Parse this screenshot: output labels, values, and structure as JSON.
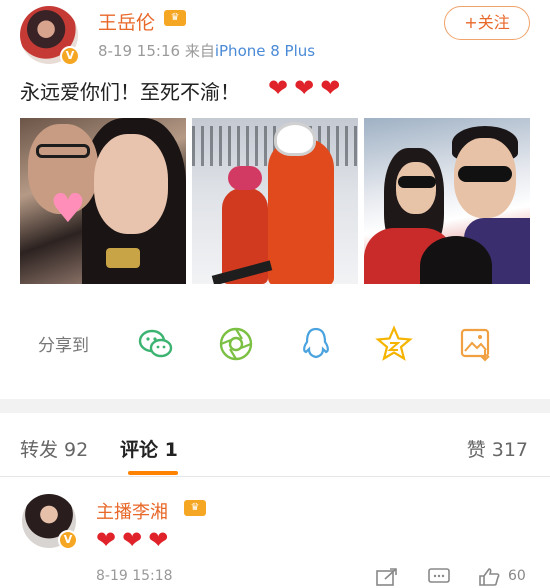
{
  "post": {
    "author_name": "王岳伦",
    "verified_badge": "V",
    "member_badge": "crown-icon",
    "date": "8-19 15:16",
    "source_prefix": "来自",
    "source_client": "iPhone 8 Plus",
    "follow_label": "+关注",
    "text": "永远爱你们！至死不渝！",
    "hearts": [
      "❤",
      "❤",
      "❤"
    ],
    "photos": [
      "photo-couple",
      "photo-ski",
      "photo-family"
    ]
  },
  "share": {
    "label": "分享到",
    "targets": [
      "wechat-icon",
      "moments-icon",
      "qq-icon",
      "qzone-icon",
      "album-icon"
    ]
  },
  "tabs": {
    "repost": "转发 92",
    "comment": "评论 1",
    "likes": "赞 317"
  },
  "comment": {
    "author_name": "主播李湘",
    "verified_badge": "V",
    "hearts": [
      "❤",
      "❤",
      "❤"
    ],
    "time": "8-19 15:18",
    "like_count": "60"
  },
  "colors": {
    "accent_orange": "#e8682a",
    "tab_underline": "#ff8200",
    "link_blue": "#4a8ad6",
    "heart_red": "#e0232a"
  }
}
